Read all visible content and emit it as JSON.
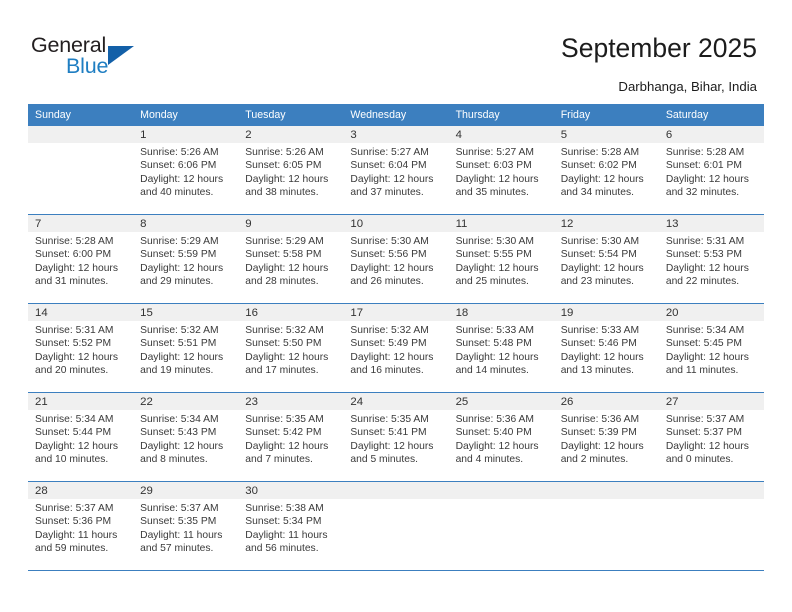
{
  "brand": {
    "line1": "General",
    "line2": "Blue",
    "accent_color": "#1360a8",
    "blue_text_color": "#1f7ec2",
    "triangle_icon": "triangle-icon"
  },
  "header": {
    "title": "September 2025",
    "location": "Darbhanga, Bihar, India",
    "header_bg_color": "#3c7fbf",
    "daynum_band_color": "#f0f0f0"
  },
  "weekday_headers": [
    "Sunday",
    "Monday",
    "Tuesday",
    "Wednesday",
    "Thursday",
    "Friday",
    "Saturday"
  ],
  "weeks": [
    [
      {
        "day": "",
        "lines": []
      },
      {
        "day": "1",
        "lines": [
          "Sunrise: 5:26 AM",
          "Sunset: 6:06 PM",
          "Daylight: 12 hours",
          "and 40 minutes."
        ]
      },
      {
        "day": "2",
        "lines": [
          "Sunrise: 5:26 AM",
          "Sunset: 6:05 PM",
          "Daylight: 12 hours",
          "and 38 minutes."
        ]
      },
      {
        "day": "3",
        "lines": [
          "Sunrise: 5:27 AM",
          "Sunset: 6:04 PM",
          "Daylight: 12 hours",
          "and 37 minutes."
        ]
      },
      {
        "day": "4",
        "lines": [
          "Sunrise: 5:27 AM",
          "Sunset: 6:03 PM",
          "Daylight: 12 hours",
          "and 35 minutes."
        ]
      },
      {
        "day": "5",
        "lines": [
          "Sunrise: 5:28 AM",
          "Sunset: 6:02 PM",
          "Daylight: 12 hours",
          "and 34 minutes."
        ]
      },
      {
        "day": "6",
        "lines": [
          "Sunrise: 5:28 AM",
          "Sunset: 6:01 PM",
          "Daylight: 12 hours",
          "and 32 minutes."
        ]
      }
    ],
    [
      {
        "day": "7",
        "lines": [
          "Sunrise: 5:28 AM",
          "Sunset: 6:00 PM",
          "Daylight: 12 hours",
          "and 31 minutes."
        ]
      },
      {
        "day": "8",
        "lines": [
          "Sunrise: 5:29 AM",
          "Sunset: 5:59 PM",
          "Daylight: 12 hours",
          "and 29 minutes."
        ]
      },
      {
        "day": "9",
        "lines": [
          "Sunrise: 5:29 AM",
          "Sunset: 5:58 PM",
          "Daylight: 12 hours",
          "and 28 minutes."
        ]
      },
      {
        "day": "10",
        "lines": [
          "Sunrise: 5:30 AM",
          "Sunset: 5:56 PM",
          "Daylight: 12 hours",
          "and 26 minutes."
        ]
      },
      {
        "day": "11",
        "lines": [
          "Sunrise: 5:30 AM",
          "Sunset: 5:55 PM",
          "Daylight: 12 hours",
          "and 25 minutes."
        ]
      },
      {
        "day": "12",
        "lines": [
          "Sunrise: 5:30 AM",
          "Sunset: 5:54 PM",
          "Daylight: 12 hours",
          "and 23 minutes."
        ]
      },
      {
        "day": "13",
        "lines": [
          "Sunrise: 5:31 AM",
          "Sunset: 5:53 PM",
          "Daylight: 12 hours",
          "and 22 minutes."
        ]
      }
    ],
    [
      {
        "day": "14",
        "lines": [
          "Sunrise: 5:31 AM",
          "Sunset: 5:52 PM",
          "Daylight: 12 hours",
          "and 20 minutes."
        ]
      },
      {
        "day": "15",
        "lines": [
          "Sunrise: 5:32 AM",
          "Sunset: 5:51 PM",
          "Daylight: 12 hours",
          "and 19 minutes."
        ]
      },
      {
        "day": "16",
        "lines": [
          "Sunrise: 5:32 AM",
          "Sunset: 5:50 PM",
          "Daylight: 12 hours",
          "and 17 minutes."
        ]
      },
      {
        "day": "17",
        "lines": [
          "Sunrise: 5:32 AM",
          "Sunset: 5:49 PM",
          "Daylight: 12 hours",
          "and 16 minutes."
        ]
      },
      {
        "day": "18",
        "lines": [
          "Sunrise: 5:33 AM",
          "Sunset: 5:48 PM",
          "Daylight: 12 hours",
          "and 14 minutes."
        ]
      },
      {
        "day": "19",
        "lines": [
          "Sunrise: 5:33 AM",
          "Sunset: 5:46 PM",
          "Daylight: 12 hours",
          "and 13 minutes."
        ]
      },
      {
        "day": "20",
        "lines": [
          "Sunrise: 5:34 AM",
          "Sunset: 5:45 PM",
          "Daylight: 12 hours",
          "and 11 minutes."
        ]
      }
    ],
    [
      {
        "day": "21",
        "lines": [
          "Sunrise: 5:34 AM",
          "Sunset: 5:44 PM",
          "Daylight: 12 hours",
          "and 10 minutes."
        ]
      },
      {
        "day": "22",
        "lines": [
          "Sunrise: 5:34 AM",
          "Sunset: 5:43 PM",
          "Daylight: 12 hours",
          "and 8 minutes."
        ]
      },
      {
        "day": "23",
        "lines": [
          "Sunrise: 5:35 AM",
          "Sunset: 5:42 PM",
          "Daylight: 12 hours",
          "and 7 minutes."
        ]
      },
      {
        "day": "24",
        "lines": [
          "Sunrise: 5:35 AM",
          "Sunset: 5:41 PM",
          "Daylight: 12 hours",
          "and 5 minutes."
        ]
      },
      {
        "day": "25",
        "lines": [
          "Sunrise: 5:36 AM",
          "Sunset: 5:40 PM",
          "Daylight: 12 hours",
          "and 4 minutes."
        ]
      },
      {
        "day": "26",
        "lines": [
          "Sunrise: 5:36 AM",
          "Sunset: 5:39 PM",
          "Daylight: 12 hours",
          "and 2 minutes."
        ]
      },
      {
        "day": "27",
        "lines": [
          "Sunrise: 5:37 AM",
          "Sunset: 5:37 PM",
          "Daylight: 12 hours",
          "and 0 minutes."
        ]
      }
    ],
    [
      {
        "day": "28",
        "lines": [
          "Sunrise: 5:37 AM",
          "Sunset: 5:36 PM",
          "Daylight: 11 hours",
          "and 59 minutes."
        ]
      },
      {
        "day": "29",
        "lines": [
          "Sunrise: 5:37 AM",
          "Sunset: 5:35 PM",
          "Daylight: 11 hours",
          "and 57 minutes."
        ]
      },
      {
        "day": "30",
        "lines": [
          "Sunrise: 5:38 AM",
          "Sunset: 5:34 PM",
          "Daylight: 11 hours",
          "and 56 minutes."
        ]
      },
      {
        "day": "",
        "lines": []
      },
      {
        "day": "",
        "lines": []
      },
      {
        "day": "",
        "lines": []
      },
      {
        "day": "",
        "lines": []
      }
    ]
  ]
}
